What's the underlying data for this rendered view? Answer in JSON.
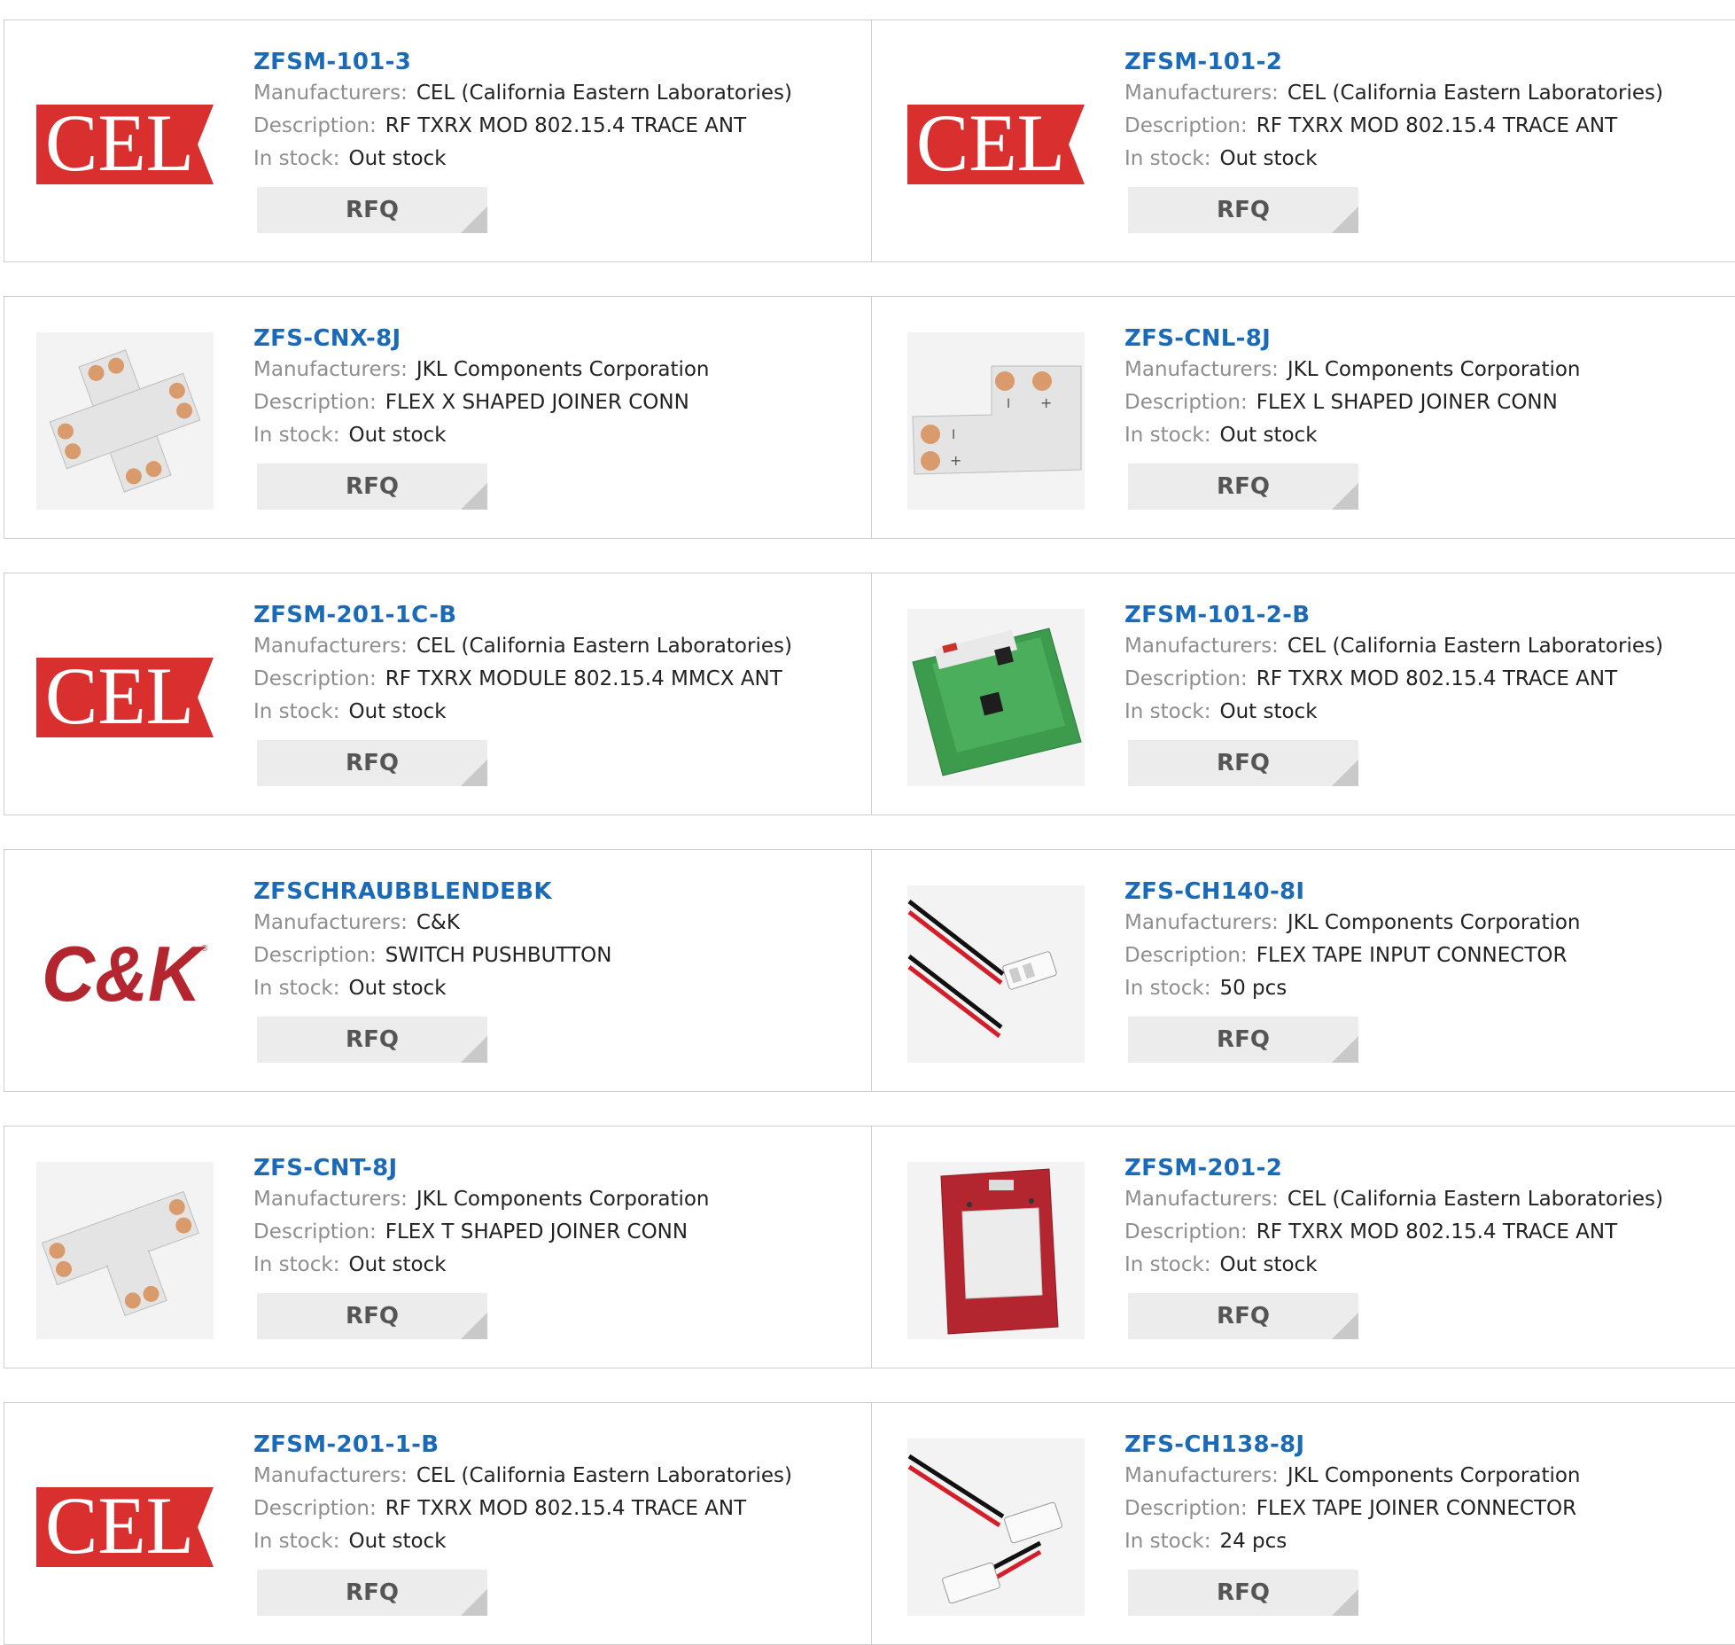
{
  "labels": {
    "manufacturers": "Manufacturers:",
    "description": "Description:",
    "in_stock": "In stock:",
    "rfq": "RFQ"
  },
  "products": [
    {
      "part": "ZFSM-101-3",
      "manufacturer": "CEL (California Eastern Laboratories)",
      "description": "RF TXRX MOD 802.15.4 TRACE ANT",
      "stock": "Out stock",
      "image": "cel-logo"
    },
    {
      "part": "ZFSM-101-2",
      "manufacturer": "CEL (California Eastern Laboratories)",
      "description": "RF TXRX MOD 802.15.4 TRACE ANT",
      "stock": "Out stock",
      "image": "cel-logo"
    },
    {
      "part": "ZFS-CNX-8J",
      "manufacturer": "JKL Components Corporation",
      "description": "FLEX X SHAPED JOINER CONN",
      "stock": "Out stock",
      "image": "x-joiner"
    },
    {
      "part": "ZFS-CNL-8J",
      "manufacturer": "JKL Components Corporation",
      "description": "FLEX L SHAPED JOINER CONN",
      "stock": "Out stock",
      "image": "l-joiner"
    },
    {
      "part": "ZFSM-201-1C-B",
      "manufacturer": "CEL (California Eastern Laboratories)",
      "description": "RF TXRX MODULE 802.15.4 MMCX ANT",
      "stock": "Out stock",
      "image": "cel-logo"
    },
    {
      "part": "ZFSM-101-2-B",
      "manufacturer": "CEL (California Eastern Laboratories)",
      "description": "RF TXRX MOD 802.15.4 TRACE ANT",
      "stock": "Out stock",
      "image": "green-module"
    },
    {
      "part": "ZFSCHRAUBBLENDEBK",
      "manufacturer": "C&K",
      "description": "SWITCH PUSHBUTTON",
      "stock": "Out stock",
      "image": "ck-logo"
    },
    {
      "part": "ZFS-CH140-8I",
      "manufacturer": "JKL Components Corporation",
      "description": "FLEX TAPE INPUT CONNECTOR",
      "stock": "50 pcs",
      "image": "wire-input"
    },
    {
      "part": "ZFS-CNT-8J",
      "manufacturer": "JKL Components Corporation",
      "description": "FLEX T SHAPED JOINER CONN",
      "stock": "Out stock",
      "image": "t-joiner"
    },
    {
      "part": "ZFSM-201-2",
      "manufacturer": "CEL (California Eastern Laboratories)",
      "description": "RF TXRX MOD 802.15.4 TRACE ANT",
      "stock": "Out stock",
      "image": "red-module"
    },
    {
      "part": "ZFSM-201-1-B",
      "manufacturer": "CEL (California Eastern Laboratories)",
      "description": "RF TXRX MOD 802.15.4 TRACE ANT",
      "stock": "Out stock",
      "image": "cel-logo"
    },
    {
      "part": "ZFS-CH138-8J",
      "manufacturer": "JKL Components Corporation",
      "description": "FLEX TAPE JOINER CONNECTOR",
      "stock": "24 pcs",
      "image": "wire-joiner"
    }
  ],
  "colors": {
    "link": "#1b6ab8",
    "label": "#8e8e8e",
    "value": "#222222",
    "button_bg": "#ececec",
    "border": "#cfcfcf",
    "cel_red": "#d92f2f"
  }
}
